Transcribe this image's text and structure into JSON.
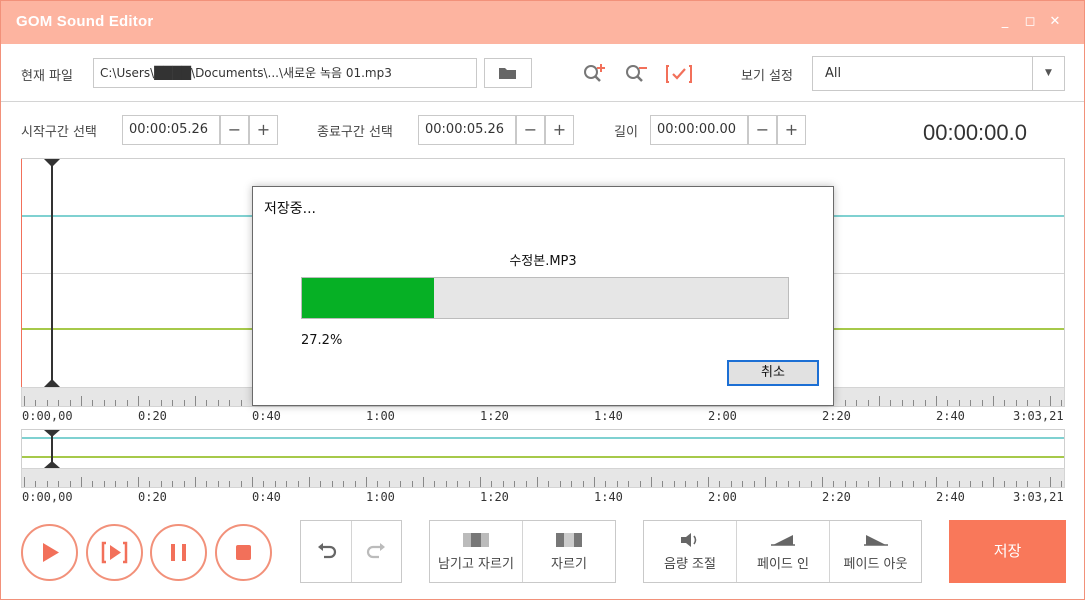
{
  "app": {
    "title": "GOM Sound Editor"
  },
  "window_controls": {
    "minimize": "_",
    "maximize": "◻",
    "close": "✕"
  },
  "file_row": {
    "label": "현재 파일",
    "path": "C:\\Users\\████\\Documents\\...\\새로운 녹음 01.mp3",
    "view_label": "보기 설정",
    "view_value": "All"
  },
  "selection_row": {
    "start_label": "시작구간 선택",
    "start_value": "00:00:05.26",
    "end_label": "종료구간 선택",
    "end_value": "00:00:05.26",
    "length_label": "길이",
    "length_value": "00:00:00.00",
    "minus": "−",
    "plus": "+",
    "current_time": "00:00:00.0"
  },
  "timeline": {
    "labels": [
      "0:00,00",
      "0:20",
      "0:40",
      "1:00",
      "1:20",
      "1:40",
      "2:00",
      "2:20",
      "2:40",
      "3:03,21"
    ]
  },
  "edit_buttons": {
    "keep_trim": "남기고 자르기",
    "trim": "자르기",
    "volume": "음량 조절",
    "fade_in": "페이드 인",
    "fade_out": "페이드 아웃",
    "save": "저장"
  },
  "dialog": {
    "title": "저장중...",
    "filename": "수정본.MP3",
    "progress": 0.272,
    "progress_text": "27.2%",
    "cancel": "취소"
  },
  "colors": {
    "accent": "#f9785a",
    "titlebar": "#fdb4a0",
    "wave_cyan": "#7fd1d1",
    "wave_green": "#a6c94a",
    "progress": "#06b025"
  }
}
